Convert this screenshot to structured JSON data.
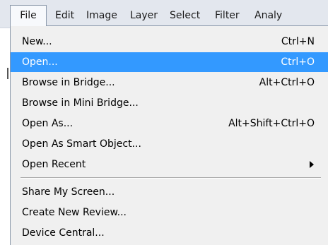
{
  "menubar": {
    "items": [
      "File",
      "Edit",
      "Image",
      "Layer",
      "Select",
      "Filter",
      "Analy"
    ]
  },
  "file_menu": {
    "items": [
      {
        "label": "New...",
        "shortcut": "Ctrl+N"
      },
      {
        "label": "Open...",
        "shortcut": "Ctrl+O",
        "highlighted": true
      },
      {
        "label": "Browse in Bridge...",
        "shortcut": "Alt+Ctrl+O"
      },
      {
        "label": "Browse in Mini Bridge...",
        "shortcut": ""
      },
      {
        "label": "Open As...",
        "shortcut": "Alt+Shift+Ctrl+O"
      },
      {
        "label": "Open As Smart Object...",
        "shortcut": ""
      },
      {
        "label": "Open Recent",
        "shortcut": "",
        "submenu": true
      },
      {
        "label": "Share My Screen...",
        "shortcut": ""
      },
      {
        "label": "Create New Review...",
        "shortcut": ""
      },
      {
        "label": "Device Central...",
        "shortcut": ""
      }
    ],
    "submenu_icon": "chevron-right-icon"
  },
  "colors": {
    "menubar_bg": "#e3e7ee",
    "menu_bg": "#f0f0f0",
    "highlight": "#3399ff",
    "highlight_text": "#ffffff"
  }
}
